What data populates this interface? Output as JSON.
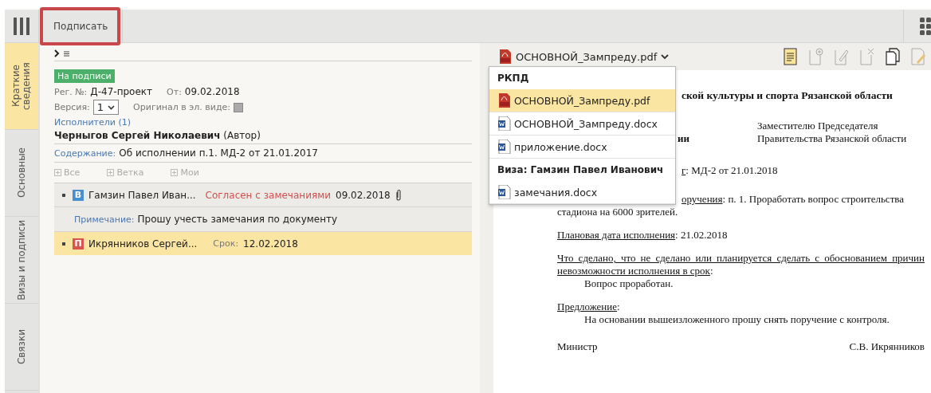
{
  "toolbar": {
    "sign_button": "Подписать",
    "highlighted": true
  },
  "side_tabs": [
    {
      "label": "Краткие сведения",
      "selected": true
    },
    {
      "label": "Основные",
      "selected": false
    },
    {
      "label": "Визы и подписи",
      "selected": false
    },
    {
      "label": "Связки",
      "selected": false
    }
  ],
  "summary": {
    "status": "На подписи",
    "reg_label": "Рег. №:",
    "reg_number": "Д-47-проект",
    "date_label": "От:",
    "date": "09.02.2018",
    "version_label": "Версия:",
    "version": "1",
    "original_label": "Оригинал в эл. виде:",
    "original_disabled": true,
    "executors_link": "Исполнители (1)",
    "author": "**Черныгов Сергей Николаевич** (Автор)",
    "content_label": "Содержание:",
    "content": "Об исполнении п.1. МД-2 от 21.01.2017",
    "filters": [
      "Все",
      "Ветка",
      "Мои"
    ],
    "approvals": [
      {
        "badge": "В",
        "color": "#4a90d0",
        "name": "Гамзин Павел Иван...",
        "status": "Согласен с замечаниями",
        "date": "09.02.2018",
        "attachment": true,
        "selected": false,
        "note_label": "Примечание:",
        "note": "Прошу учесть замечания по документу"
      },
      {
        "badge": "П",
        "color": "#d9534f",
        "name": "Икрянников Сергей...",
        "due_label": "Срок:",
        "date": "12.02.2018",
        "attachment": false,
        "selected": true
      }
    ]
  },
  "viewer": {
    "file": "ОСНОВНОЙ_Зампреду.pdf",
    "tools": [
      {
        "kind": "view",
        "disabled": false
      },
      {
        "kind": "add",
        "disabled": true
      },
      {
        "kind": "edit",
        "disabled": true
      },
      {
        "kind": "delete",
        "disabled": true
      },
      {
        "kind": "copy",
        "disabled": false
      },
      {
        "kind": "sign",
        "disabled": true
      }
    ],
    "dropdown": [
      {
        "title": "РКПД",
        "files": [
          {
            "name": "ОСНОВНОЙ_Зампреду.pdf",
            "kind": "pdf",
            "selected": true
          },
          {
            "name": "ОСНОВНОЙ_Зампреду.docx",
            "kind": "doc",
            "selected": false
          },
          {
            "name": "приложение.docx",
            "kind": "doc",
            "selected": false
          }
        ]
      },
      {
        "title": "Виза: Гамзин Павел Иванович",
        "files": [
          {
            "name": "замечания.docx",
            "kind": "doc",
            "selected": false
          }
        ]
      }
    ],
    "document": {
      "heading": "ской культуры и спорта Рязанской области",
      "fragment": "ии",
      "addressee": [
        "Заместителю Председателя",
        "Правительства Рязанской области"
      ],
      "paragraphs": [
        {
          "kind": "field",
          "partial": true,
          "label": "г",
          "text": ": МД-2 от 21.01.2018"
        },
        {
          "kind": "field",
          "partial": true,
          "label": "оручения",
          "text": ": п. 1. Проработать вопрос строительства"
        },
        {
          "kind": "continuation",
          "text": "стадиона на 6000 зрителей."
        },
        {
          "kind": "field",
          "label": "Плановая дата исполнения",
          "text": ": 21.02.2018"
        },
        {
          "kind": "field",
          "label": "Что сделано, что не сделано или планируется сделать с обоснованием причин невозможности исполнения в срок",
          "text": ":"
        },
        {
          "kind": "indented",
          "text": "Вопрос проработан."
        },
        {
          "kind": "field",
          "label": "Предложение",
          "text": ":"
        },
        {
          "kind": "indented",
          "text": "На основании вышеизложенного прошу снять поручение с контроля."
        }
      ],
      "position": "Министр",
      "signer": "С.В. Икрянников"
    }
  }
}
